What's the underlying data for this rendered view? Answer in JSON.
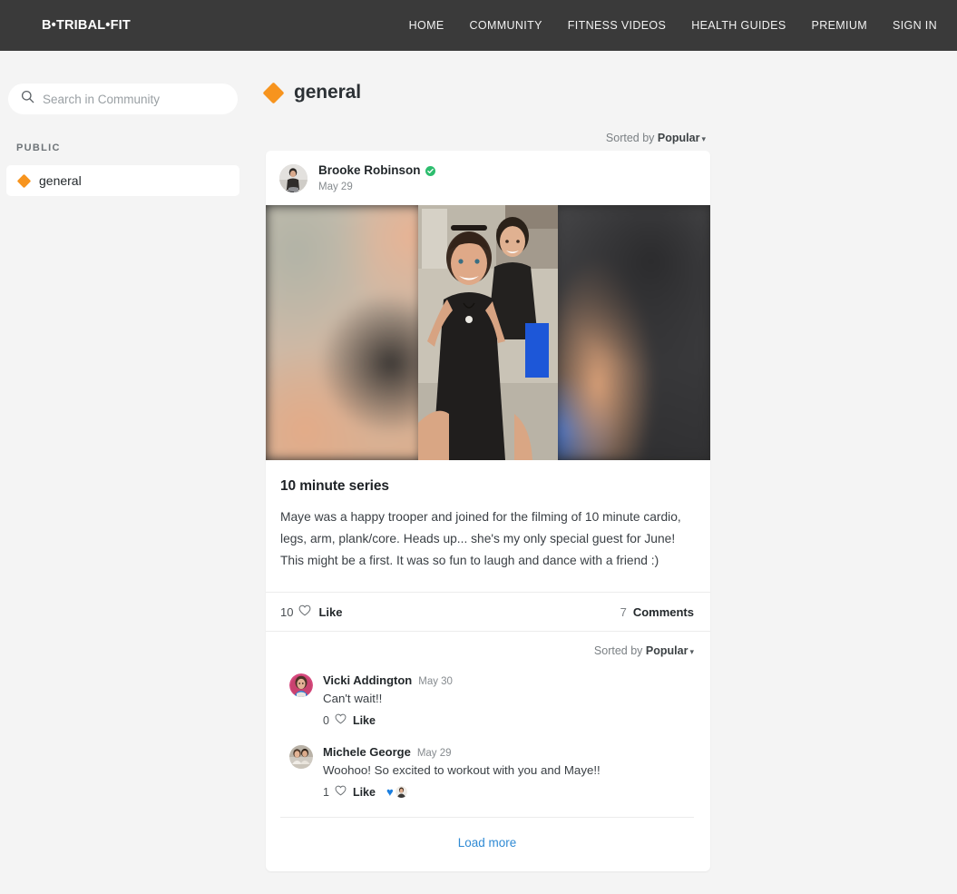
{
  "topbar": {
    "logo": "B•TRIBAL•FIT",
    "nav": [
      {
        "label": "HOME"
      },
      {
        "label": "COMMUNITY"
      },
      {
        "label": "FITNESS VIDEOS"
      },
      {
        "label": "HEALTH GUIDES"
      },
      {
        "label": "PREMIUM"
      },
      {
        "label": "SIGN IN"
      }
    ],
    "bg_color": "#3a3a3a"
  },
  "sidebar": {
    "search": {
      "value": "",
      "placeholder": "Search in Community",
      "icon": "search-icon"
    },
    "section_label": "PUBLIC",
    "channels": [
      {
        "label": "general",
        "icon": "diamond-icon",
        "icon_color": "#f7941e",
        "active": true
      }
    ]
  },
  "main": {
    "page_title": "general",
    "page_icon_color": "#f7941e",
    "sort": {
      "prefix": "Sorted by",
      "value": "Popular",
      "caret": "▾"
    }
  },
  "post": {
    "author": "Brooke Robinson",
    "verified": true,
    "date": "May 29",
    "title": "10 minute series",
    "text": "Maye was a happy trooper and joined for the filming of 10 minute cardio, legs, arm, plank/core. Heads up... she's my only special guest for June! This might be a first. It was so fun to laugh and dance with a friend :)",
    "like_count": "10",
    "like_label": "Like",
    "comment_count": "7",
    "comment_label": "Comments"
  },
  "comments_section": {
    "sort": {
      "prefix": "Sorted by",
      "value": "Popular",
      "caret": "▾"
    },
    "items": [
      {
        "author": "Vicki Addington",
        "date": "May 30",
        "text": "Can't wait!!",
        "like_count": "0",
        "like_label": "Like",
        "reaction": ""
      },
      {
        "author": "Michele George",
        "date": "May 29",
        "text": "Woohoo! So excited to workout with you and Maye!!",
        "like_count": "1",
        "like_label": "Like",
        "reaction": "♥"
      }
    ],
    "load_more": "Load more"
  },
  "colors": {
    "accent_orange": "#f7941e",
    "verified_green": "#2dbd6e",
    "link_blue": "#2f8ad4",
    "page_bg": "#f4f4f4"
  }
}
